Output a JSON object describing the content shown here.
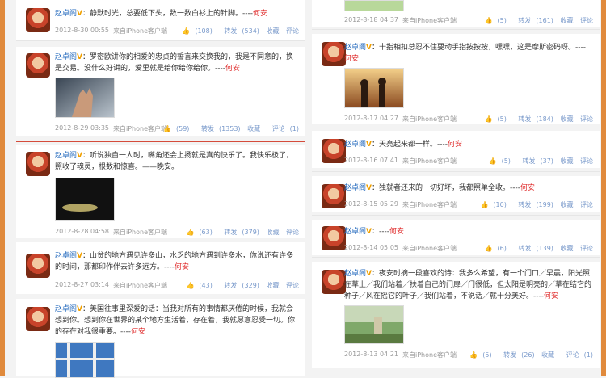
{
  "user": {
    "name": "赵卓阁",
    "author_sign": "何安",
    "source": "来自iPhone客户端"
  },
  "actions": {
    "forward": "转发",
    "fav": "收藏",
    "comment": "评论"
  },
  "left_posts": [
    {
      "text": "静默时光，总要低下头，数一数白衫上的针脚。",
      "time": "2012-8-30 00:55",
      "likes": "(108)",
      "forwards": "(534)",
      "comments": ""
    },
    {
      "text": "罗密欧讲你的相爱的忠贞的誓言来交换我的，我是不同意的，换是交易。没什么好讲的，爱里就是给你给你给你。",
      "time": "2012-8-29 03:35",
      "likes": "(59)",
      "forwards": "(1353)",
      "comments": "(1)"
    },
    {
      "text": "听说独自一人时，嘴角还会上扬就是真的快乐了。我快乐极了，照收了魂灵，根数和惊喜。",
      "author_prefix": "——晚安。",
      "time": "2012-8-28 04:58",
      "likes": "(63)",
      "forwards": "(379)",
      "comments": ""
    },
    {
      "text": "山贫的地方遇见许多山，水乏的地方遇到许多水，你说还有许多的时间，那都印作伴去许多远方。",
      "time": "2012-8-27 03:14",
      "likes": "(43)",
      "forwards": "(329)",
      "comments": ""
    },
    {
      "text": "美国往事里深爱的话：当我对所有的事情都厌倦的时候，我就会想到你。想到你在世界的某个地方生活着，存在着，我就愿意忍受一切。你的存在对我很重要。",
      "time": "",
      "likes": "",
      "forwards": "",
      "comments": ""
    }
  ],
  "right_posts": [
    {
      "text": "",
      "time": "2012-8-18 04:37",
      "likes": "(5)",
      "forwards": "(161)",
      "comments": ""
    },
    {
      "text": "十指相扣总忍不住要动手指按按按，嘿嘿，这是摩斯密码呀。",
      "time": "2012-8-17 04:27",
      "likes": "(5)",
      "forwards": "(184)",
      "comments": ""
    },
    {
      "text": "天亮起来都一样。",
      "time": "2012-8-16 07:41",
      "likes": "(5)",
      "forwards": "(37)",
      "comments": ""
    },
    {
      "text": "独就者还来的一切好坏，我都照单全收。",
      "time": "2012-8-15 05:29",
      "likes": "(10)",
      "forwards": "(199)",
      "comments": ""
    },
    {
      "text": "",
      "time": "2012-8-14 05:05",
      "likes": "(6)",
      "forwards": "(139)",
      "comments": ""
    },
    {
      "text": "夜安时摘一段喜欢的诗：我多么希望，有一个门口／早晨，阳光照在草上／我们站着／扶着自己的门扉／门很低，但太阳是明亮的／草在结它的种子／风在摇它的叶子／我们站着，不说话／就十分美好。",
      "time": "2012-8-13 04:21",
      "likes": "(5)",
      "forwards": "(26)",
      "comments": "(1)"
    }
  ],
  "icons": {
    "thumb": "thumb-up-icon",
    "avatar": "avatar-image"
  },
  "colors": {
    "frame": "#e08a3c",
    "link": "#2a6ebf",
    "author": "#e03030",
    "divider": "#d54b3b"
  }
}
